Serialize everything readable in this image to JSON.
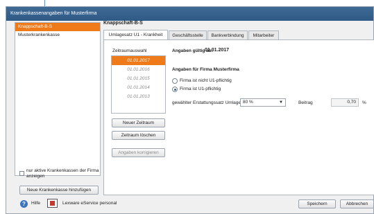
{
  "window": {
    "title": "Krankenkassenangaben für Musterfirma"
  },
  "kassen": {
    "items": [
      {
        "label": "Knappschaft-B-S",
        "selected": true
      },
      {
        "label": "Musterkrankenkasse",
        "selected": false
      }
    ],
    "only_active_checkbox": {
      "label": "nur aktive Krankenkassen der Firma anzeigen",
      "checked": false
    },
    "add_button": "Neue Krankenkasse hinzufügen"
  },
  "footer": {
    "help_label": "Hilfe",
    "eservice_label": "Lexware eService personal",
    "save_button": "Speichern",
    "cancel_button": "Abbrechen"
  },
  "detail": {
    "title": "Knappschaft-B-S",
    "tabs": [
      {
        "label": "Umlagesatz U1 - Krankheit",
        "active": true
      },
      {
        "label": "Geschäftsstelle",
        "active": false
      },
      {
        "label": "Bankverbindung",
        "active": false
      },
      {
        "label": "Mitarbeiter",
        "active": false
      }
    ],
    "zeitraum": {
      "label": "Zeitraumauswahl",
      "items": [
        {
          "label": "01.01.2017",
          "selected": true
        },
        {
          "label": "01.01.2016",
          "selected": false
        },
        {
          "label": "01.01.2015",
          "selected": false
        },
        {
          "label": "01.01.2014",
          "selected": false
        },
        {
          "label": "01.01.2013",
          "selected": false
        }
      ],
      "new_button": "Neuer Zeitraum",
      "delete_button": "Zeitraum löschen",
      "correct_button": "Angaben korrigieren"
    },
    "valid_from_label": "Angaben gültig ab:",
    "valid_from_value": "01.01.2017",
    "firma_heading": "Angaben für Firma Musterfirma",
    "radio_not_obliged": {
      "label": "Firma ist nicht U1-pflichtig",
      "checked": false
    },
    "radio_obliged": {
      "label": "Firma ist U1-pflichtig",
      "checked": true
    },
    "rate_label": "gewählter Erstattungssatz Umlage U1",
    "rate_value": "80 %",
    "beitrag_label": "Beitrag",
    "beitrag_value": "0,70",
    "beitrag_unit": "%"
  },
  "colors": {
    "accent": "#ee7a1a",
    "callout": "#3d9bd6",
    "titlebar": "#2f5a86"
  }
}
